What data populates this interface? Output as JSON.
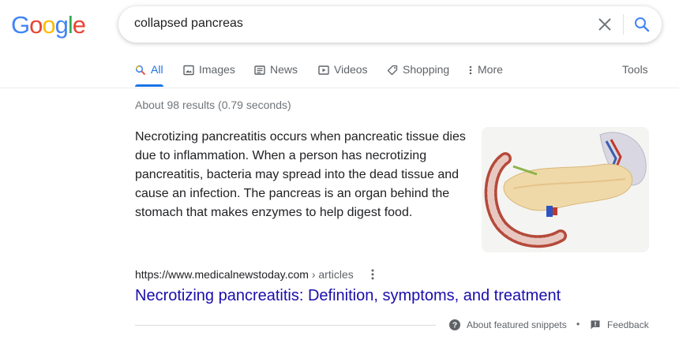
{
  "logo": {
    "letters": [
      "G",
      "o",
      "o",
      "g",
      "l",
      "e"
    ],
    "colors": [
      "#4285f4",
      "#ea4335",
      "#fbbc05",
      "#4285f4",
      "#34a853",
      "#ea4335"
    ]
  },
  "search": {
    "query": "collapsed pancreas"
  },
  "tabs": [
    {
      "label": "All",
      "icon": "search-icon",
      "active": true
    },
    {
      "label": "Images",
      "icon": "image-icon"
    },
    {
      "label": "News",
      "icon": "news-icon"
    },
    {
      "label": "Videos",
      "icon": "video-icon"
    },
    {
      "label": "Shopping",
      "icon": "tag-icon"
    },
    {
      "label": "More",
      "icon": "more-vert-icon"
    }
  ],
  "tools_label": "Tools",
  "result_stats": "About 98 results (0.79 seconds)",
  "featured_snippet": {
    "text": "Necrotizing pancreatitis occurs when pancreatic tissue dies due to inflammation. When a person has necrotizing pancreatitis, bacteria may spread into the dead tissue and cause an infection. The pancreas is an organ behind the stomach that makes enzymes to help digest food.",
    "image": "pancreas-illustration"
  },
  "result": {
    "url": "https://www.medicalnewstoday.com",
    "breadcrumb": " › articles",
    "title": "Necrotizing pancreatitis: Definition, symptoms, and treatment"
  },
  "footer": {
    "about": "About featured snippets",
    "separator": "•",
    "feedback": "Feedback"
  },
  "colors": {
    "link": "#1a0dab",
    "accent": "#1a73e8"
  }
}
